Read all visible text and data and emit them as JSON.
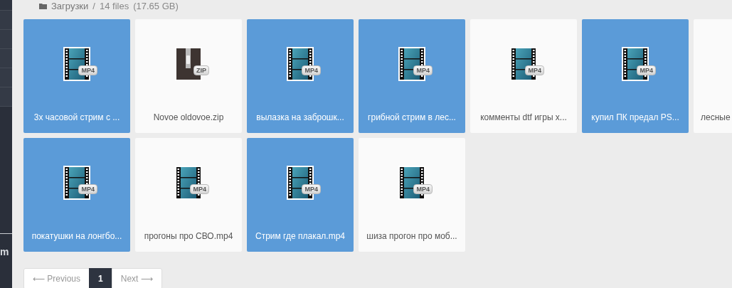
{
  "sidebar": {
    "items": [
      {
        "kind": "nav"
      },
      {
        "kind": "nav"
      },
      {
        "kind": "nav"
      },
      {
        "kind": "nav"
      },
      {
        "kind": "nav"
      }
    ],
    "footer_fragment": "m"
  },
  "breadcrumb": {
    "folder": "Загрузки",
    "separator": "/",
    "count": "14 files",
    "size": "(17.65 GB)"
  },
  "files": [
    {
      "name": "3х часовой стрим с ...",
      "kind": "video",
      "badge": "MP4",
      "selected": true
    },
    {
      "name": "Novoe oldovoe.zip",
      "kind": "archive",
      "badge": "ZIP",
      "selected": false
    },
    {
      "name": "вылазка на заброшк...",
      "kind": "video",
      "badge": "MP4",
      "selected": true
    },
    {
      "name": "грибной стрим в лес...",
      "kind": "video",
      "badge": "MP4",
      "selected": true
    },
    {
      "name": "комменты dtf игры х...",
      "kind": "video",
      "badge": "MP4",
      "selected": false
    },
    {
      "name": "купил ПК предал PS...",
      "kind": "video",
      "badge": "MP4",
      "selected": true
    },
    {
      "name": "лесные",
      "selected": false
    },
    {
      "name": "покатушки на лонгбо...",
      "kind": "video",
      "badge": "MP4",
      "selected": true
    },
    {
      "name": "прогоны про СВО.mp4",
      "kind": "video",
      "badge": "MP4",
      "selected": false
    },
    {
      "name": "Стрим где плакал.mp4",
      "kind": "video",
      "badge": "MP4",
      "selected": true
    },
    {
      "name": "шиза прогон про моб...",
      "kind": "video",
      "badge": "MP4",
      "selected": false
    }
  ],
  "pagination": {
    "previous": "⟵ Previous",
    "pages": [
      {
        "label": "1",
        "selected": true
      }
    ],
    "next": "Next ⟶"
  }
}
